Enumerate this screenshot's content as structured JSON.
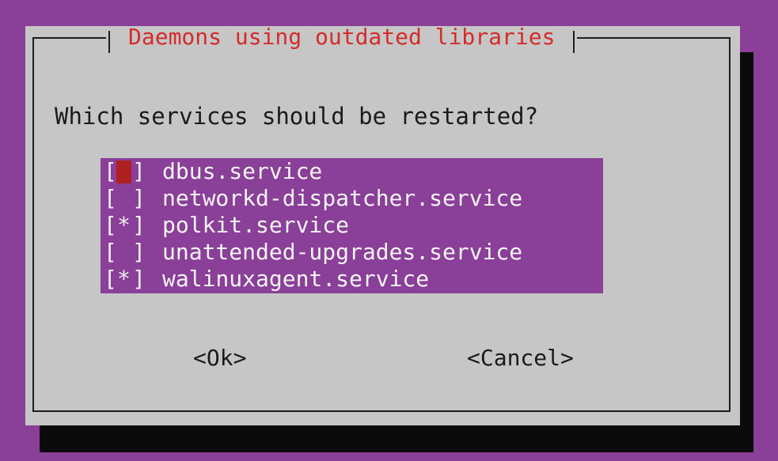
{
  "dialog": {
    "title": "Daemons using outdated libraries",
    "prompt": "Which services should be restarted?"
  },
  "checkbox": {
    "left": "[",
    "right": "]"
  },
  "services": [
    {
      "name": "dbus.service",
      "mark": " ",
      "checked": false,
      "focused": true
    },
    {
      "name": "networkd-dispatcher.service",
      "mark": " ",
      "checked": false,
      "focused": false
    },
    {
      "name": "polkit.service",
      "mark": "*",
      "checked": true,
      "focused": false
    },
    {
      "name": "unattended-upgrades.service",
      "mark": " ",
      "checked": false,
      "focused": false
    },
    {
      "name": "walinuxagent.service",
      "mark": "*",
      "checked": true,
      "focused": false
    }
  ],
  "buttons": {
    "ok": "<Ok>",
    "cancel": "<Cancel>"
  },
  "colors": {
    "background": "#8a3f98",
    "dialog": "#c6c6c6",
    "title_text": "#d52b2b",
    "list_bg": "#8a3f98",
    "cursor": "#b02020"
  }
}
